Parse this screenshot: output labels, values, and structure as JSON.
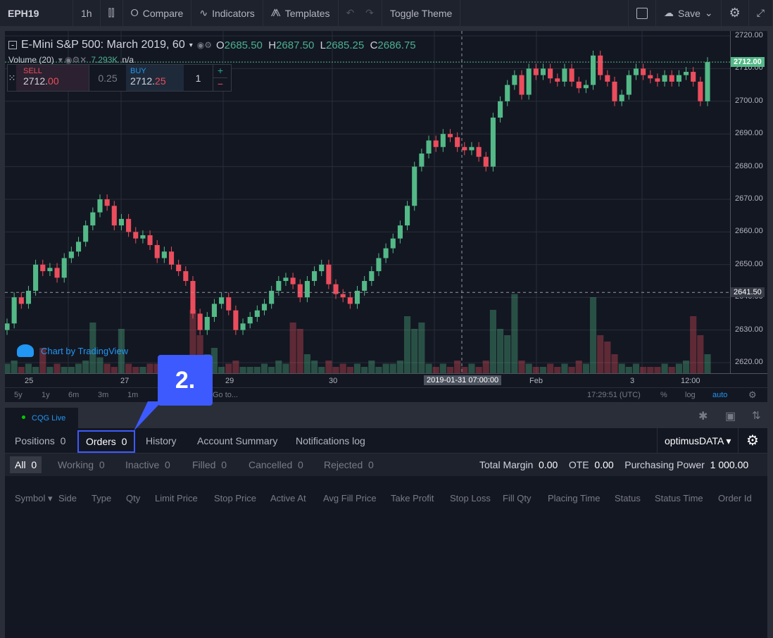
{
  "toolbar": {
    "symbol": "EPH19",
    "interval": "1h",
    "compare": "Compare",
    "indicators": "Indicators",
    "templates": "Templates",
    "toggle_theme": "Toggle Theme",
    "save": "Save"
  },
  "legend": {
    "title": "E-Mini S&P 500: March 2019, 60",
    "o_label": "O",
    "o": "2685.50",
    "h_label": "H",
    "h": "2687.50",
    "l_label": "L",
    "l": "2685.25",
    "c_label": "C",
    "c": "2686.75",
    "volume_label": "Volume (20)",
    "volume_value": "7.293K",
    "volume_na": "n/a"
  },
  "trade": {
    "sell_label": "SELL",
    "sell_int": "2712.",
    "sell_dec": "00",
    "spread": "0.25",
    "buy_label": "BUY",
    "buy_int": "2712.",
    "buy_dec": "25",
    "qty": "1"
  },
  "watermark": "Chart by TradingView",
  "crosshair": {
    "price": "2641.50",
    "time": "2019-01-31 07:00:00"
  },
  "last_price": "2712.00",
  "colors": {
    "up": "#53b987",
    "down": "#eb4d5c",
    "accent": "#3d5afe"
  },
  "chart_data": {
    "type": "candlestick",
    "ylim": [
      2617,
      2721
    ],
    "price_ticks": [
      "2720.00",
      "2710.00",
      "2700.00",
      "2690.00",
      "2680.00",
      "2670.00",
      "2660.00",
      "2650.00",
      "2640.00",
      "2630.00",
      "2620.00"
    ],
    "time_ticks": [
      "25",
      "27",
      "29",
      "30",
      "Feb",
      "3",
      "12:00"
    ],
    "closes": [
      2632,
      2640,
      2638,
      2642,
      2650,
      2648,
      2649,
      2646,
      2652,
      2654,
      2657,
      2662,
      2666,
      2670,
      2668,
      2662,
      2664,
      2660,
      2658,
      2659,
      2656,
      2652,
      2654,
      2650,
      2648,
      2645,
      2635,
      2630,
      2634,
      2638,
      2640,
      2636,
      2630,
      2632,
      2634,
      2636,
      2638,
      2642,
      2645,
      2646,
      2644,
      2640,
      2645,
      2648,
      2650,
      2644,
      2641,
      2640,
      2638,
      2642,
      2645,
      2648,
      2652,
      2655,
      2658,
      2662,
      2668,
      2680,
      2684,
      2688,
      2686,
      2690,
      2689,
      2686,
      2685,
      2686,
      2683,
      2680,
      2695,
      2700,
      2705,
      2708,
      2702,
      2710,
      2708,
      2710,
      2707,
      2706,
      2710,
      2706,
      2704,
      2705,
      2714,
      2708,
      2706,
      2700,
      2702,
      2708,
      2710,
      2708,
      2707,
      2706,
      2708,
      2706,
      2708,
      2709,
      2706,
      2700,
      2712
    ],
    "volumes": [
      3,
      4,
      2,
      3,
      2,
      8,
      2,
      3,
      2,
      2,
      3,
      4,
      16,
      5,
      3,
      2,
      14,
      3,
      2,
      2,
      3,
      3,
      2,
      3,
      2,
      4,
      20,
      12,
      6,
      8,
      2,
      3,
      4,
      2,
      2,
      2,
      3,
      2,
      4,
      3,
      16,
      14,
      6,
      4,
      2,
      4,
      2,
      3,
      2,
      3,
      2,
      4,
      2,
      3,
      3,
      4,
      18,
      14,
      16,
      3,
      2,
      3,
      2,
      4,
      2,
      3,
      2,
      4,
      20,
      14,
      12,
      25,
      4,
      3,
      2,
      2,
      3,
      2,
      3,
      2,
      4,
      3,
      24,
      12,
      10,
      6,
      3,
      2,
      3,
      2,
      2,
      2,
      3,
      2,
      3,
      4,
      18,
      12,
      6
    ]
  },
  "range_buttons": [
    "5y",
    "1y",
    "6m",
    "3m",
    "1m"
  ],
  "goto": "Go to...",
  "clock": "17:29:51 (UTC)",
  "pct": "%",
  "log": "log",
  "auto": "auto",
  "broker": "CQG Live",
  "annotation": "2.",
  "tabs": [
    {
      "label": "Positions",
      "count": "0"
    },
    {
      "label": "Orders",
      "count": "0"
    },
    {
      "label": "History"
    },
    {
      "label": "Account Summary"
    },
    {
      "label": "Notifications log"
    }
  ],
  "account": "optimusDATA",
  "filters": [
    {
      "label": "All",
      "count": "0"
    },
    {
      "label": "Working",
      "count": "0"
    },
    {
      "label": "Inactive",
      "count": "0"
    },
    {
      "label": "Filled",
      "count": "0"
    },
    {
      "label": "Cancelled",
      "count": "0"
    },
    {
      "label": "Rejected",
      "count": "0"
    }
  ],
  "summary": {
    "margin_label": "Total Margin",
    "margin": "0.00",
    "ote_label": "OTE",
    "ote": "0.00",
    "pp_label": "Purchasing Power",
    "pp": "1 000.00"
  },
  "columns": [
    "Symbol",
    "Side",
    "Type",
    "Qty",
    "Limit Price",
    "Stop Price",
    "Active At",
    "Avg Fill Price",
    "Take Profit",
    "Stop Loss",
    "Fill Qty",
    "Placing Time",
    "Status",
    "Status Time",
    "Order Id"
  ]
}
